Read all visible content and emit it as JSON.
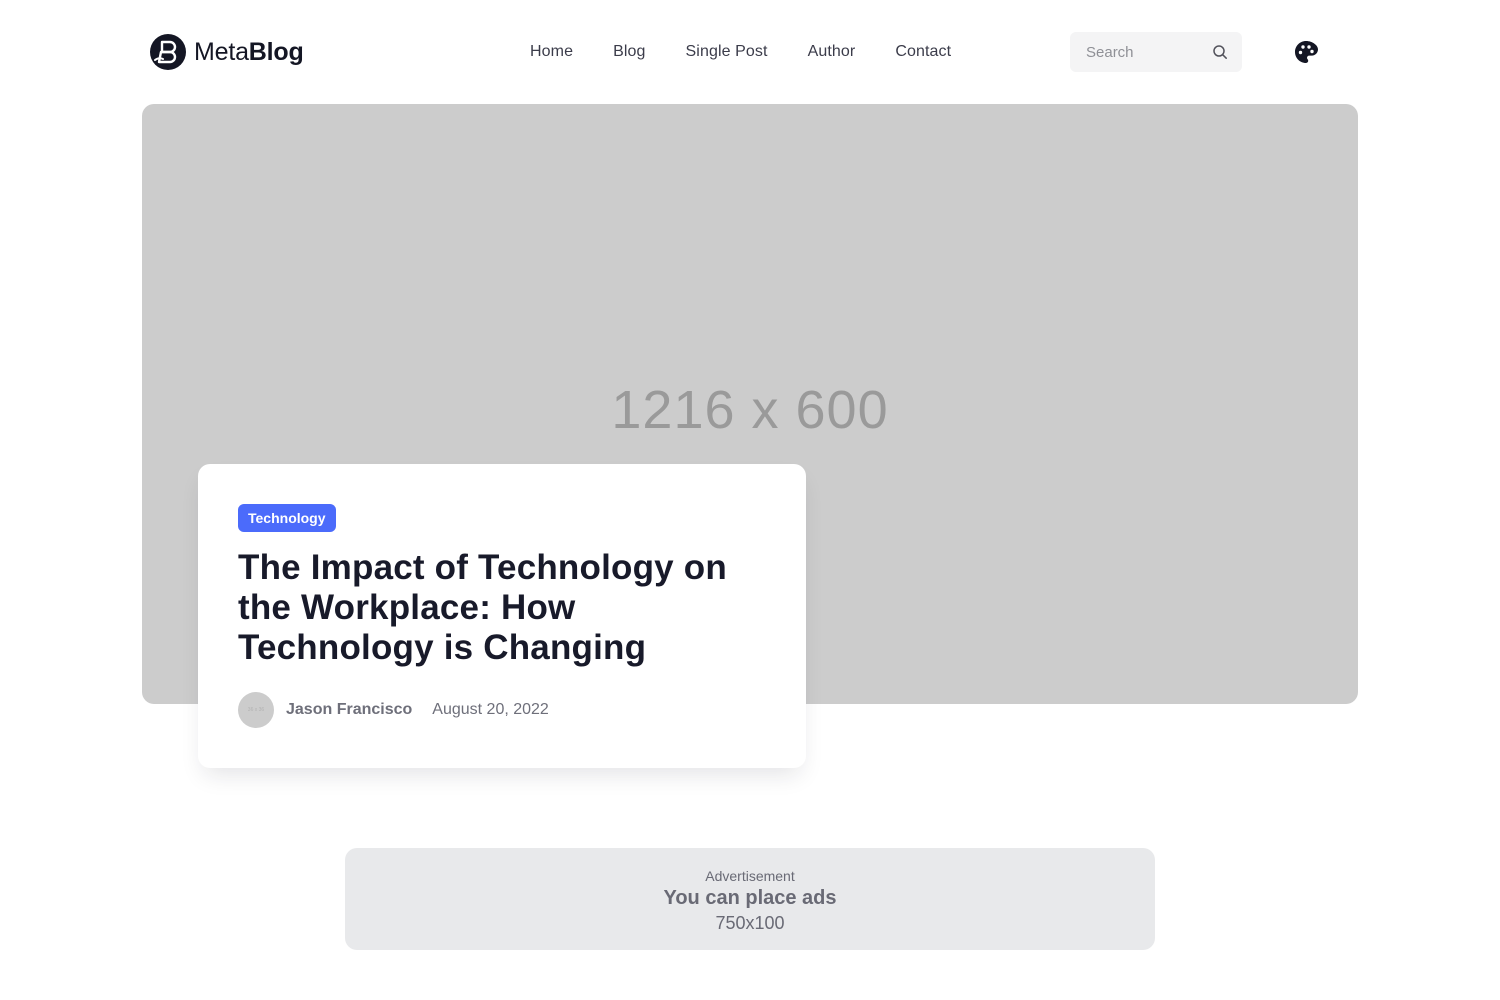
{
  "header": {
    "logo": {
      "light": "Meta",
      "bold": "Blog",
      "icon": "metablog-logo-icon"
    },
    "nav": [
      {
        "label": "Home"
      },
      {
        "label": "Blog"
      },
      {
        "label": "Single Post"
      },
      {
        "label": "Author"
      },
      {
        "label": "Contact"
      }
    ],
    "search": {
      "placeholder": "Search",
      "value": "",
      "icon": "search-icon"
    },
    "theme_toggle_icon": "palette-icon"
  },
  "hero": {
    "image_placeholder": "1216 x 600",
    "post": {
      "category": "Technology",
      "title": "The Impact of Technology on the Workplace: How Technology is Changing",
      "author": "Jason Francisco",
      "avatar_placeholder": "36 x 36",
      "date": "August 20, 2022"
    }
  },
  "advertisement": {
    "label": "Advertisement",
    "title": "You can place ads",
    "size": "750x100"
  },
  "colors": {
    "accent": "#4b6bfb",
    "text_dark": "#181a2a",
    "text_muted": "#6e6f7a",
    "placeholder_bg": "#cccccc",
    "ad_bg": "#e8e9eb"
  }
}
